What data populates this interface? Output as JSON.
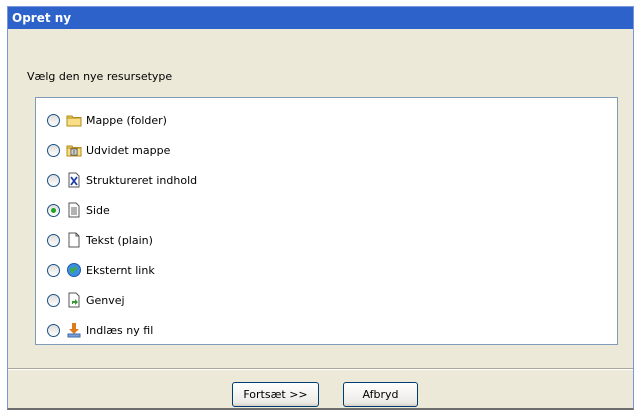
{
  "dialog": {
    "title": "Opret ny",
    "prompt": "Vælg den nye resursetype"
  },
  "resource_types": [
    {
      "label": "Mappe (folder)",
      "icon": "folder-icon",
      "selected": false
    },
    {
      "label": "Udvidet mappe",
      "icon": "extended-folder-icon",
      "selected": false
    },
    {
      "label": "Struktureret indhold",
      "icon": "structured-content-icon",
      "selected": false
    },
    {
      "label": "Side",
      "icon": "page-icon",
      "selected": true
    },
    {
      "label": "Tekst (plain)",
      "icon": "text-file-icon",
      "selected": false
    },
    {
      "label": "Eksternt link",
      "icon": "external-link-icon",
      "selected": false
    },
    {
      "label": "Genvej",
      "icon": "shortcut-icon",
      "selected": false
    },
    {
      "label": "Indlæs ny fil",
      "icon": "upload-file-icon",
      "selected": false
    }
  ],
  "buttons": {
    "continue_label": "Fortsæt >>",
    "cancel_label": "Afbryd"
  },
  "colors": {
    "titlebar": "#2c62c9",
    "dialog_background": "#ece9d8",
    "list_border": "#7f9db9",
    "radio_dot": "#21a121"
  }
}
